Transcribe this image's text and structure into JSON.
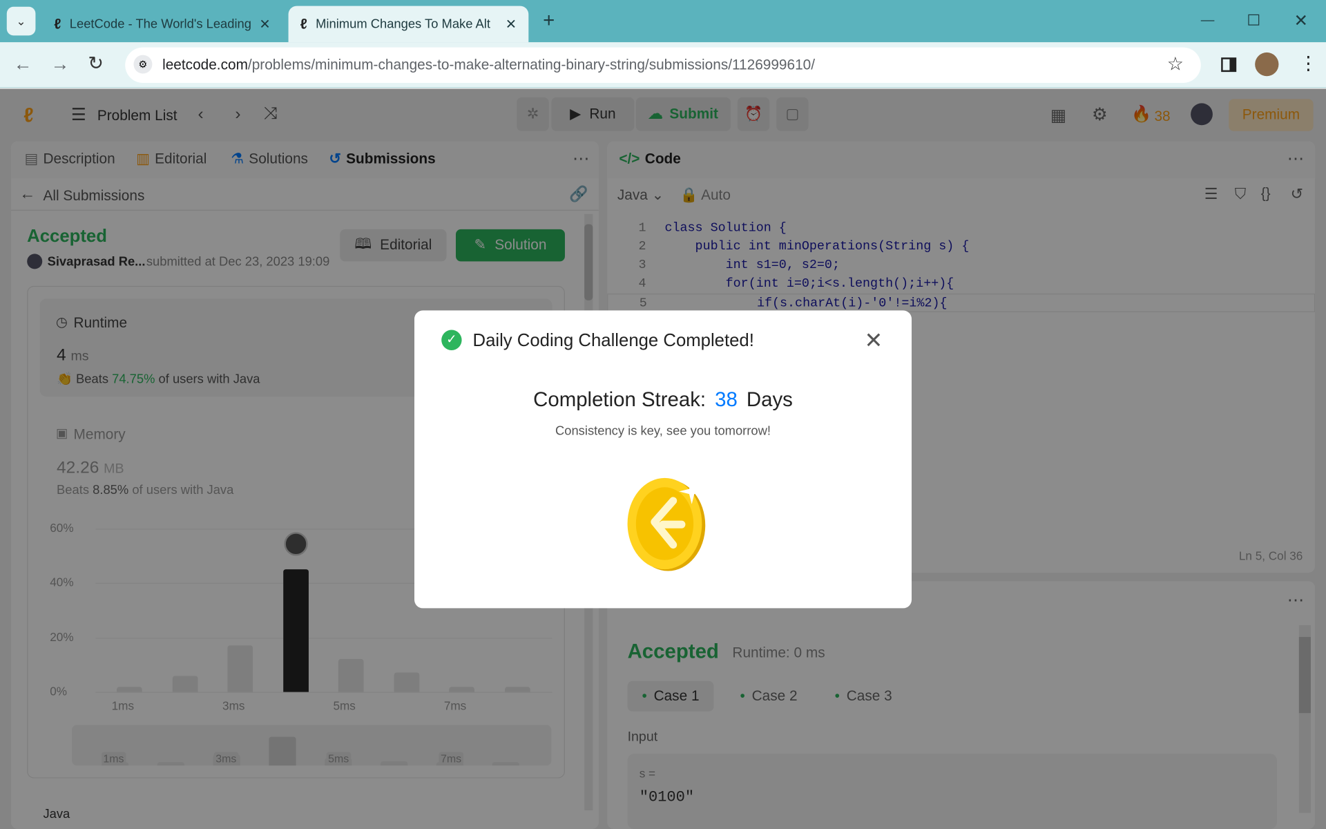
{
  "browser": {
    "tabs": [
      {
        "title": "LeetCode - The World's Leading"
      },
      {
        "title": "Minimum Changes To Make Alt"
      }
    ],
    "url_host": "leetcode.com",
    "url_path": "/problems/minimum-changes-to-make-alternating-binary-string/submissions/1126999610/"
  },
  "toolbar": {
    "problem_list": "Problem List",
    "run": "Run",
    "submit": "Submit",
    "streak": "38",
    "premium": "Premium"
  },
  "left_tabs": {
    "description": "Description",
    "editorial": "Editorial",
    "solutions": "Solutions",
    "submissions": "Submissions"
  },
  "submission": {
    "back": "All Submissions",
    "status": "Accepted",
    "user": "Sivaprasad Re...",
    "submitted": "submitted at Dec 23, 2023 19:09",
    "editorial_btn": "Editorial",
    "solution_btn": "Solution",
    "runtime_label": "Runtime",
    "runtime_value": "4",
    "runtime_unit": "ms",
    "runtime_beats_pre": "Beats",
    "runtime_beats": "74.75%",
    "runtime_beats_post": "of users with Java",
    "memory_label": "Memory",
    "memory_value": "42.26",
    "memory_unit": "MB",
    "memory_beats_pre": "Beats",
    "memory_beats": "8.85%",
    "memory_beats_post": "of users with Java",
    "lang": "Java"
  },
  "chart_data": {
    "type": "bar",
    "y_ticks": [
      "60%",
      "40%",
      "20%",
      "0%"
    ],
    "x_ticks": [
      "1ms",
      "3ms",
      "5ms",
      "7ms"
    ],
    "values": [
      2,
      6,
      17,
      45,
      12,
      7,
      2,
      2
    ],
    "highlight_index": 3,
    "ylim": [
      0,
      60
    ],
    "mini_ticks": [
      "1ms",
      "3ms",
      "5ms",
      "7ms"
    ]
  },
  "code": {
    "title": "Code",
    "lang": "Java",
    "mode": "Auto",
    "status": "Ln 5, Col 36",
    "lines": [
      {
        "n": "1",
        "text": "class Solution {"
      },
      {
        "n": "2",
        "text": "    public int minOperations(String s) {"
      },
      {
        "n": "3",
        "text": "        int s1=0, s2=0;"
      },
      {
        "n": "4",
        "text": "        for(int i=0;i<s.length();i++){"
      },
      {
        "n": "5",
        "text": "            if(s.charAt(i)-'0'!=i%2){"
      }
    ]
  },
  "result": {
    "status": "Accepted",
    "runtime": "Runtime: 0 ms",
    "cases": [
      "Case 1",
      "Case 2",
      "Case 3"
    ],
    "input_label": "Input",
    "var": "s =",
    "value": "\"0100\""
  },
  "modal": {
    "title": "Daily Coding Challenge Completed!",
    "streak_label": "Completion Streak:",
    "streak_value": "38",
    "streak_unit": "Days",
    "message": "Consistency is key, see you tomorrow!"
  },
  "colors": {
    "accepted": "#2db55d",
    "blue": "#007aff",
    "orange": "#ffa116"
  }
}
